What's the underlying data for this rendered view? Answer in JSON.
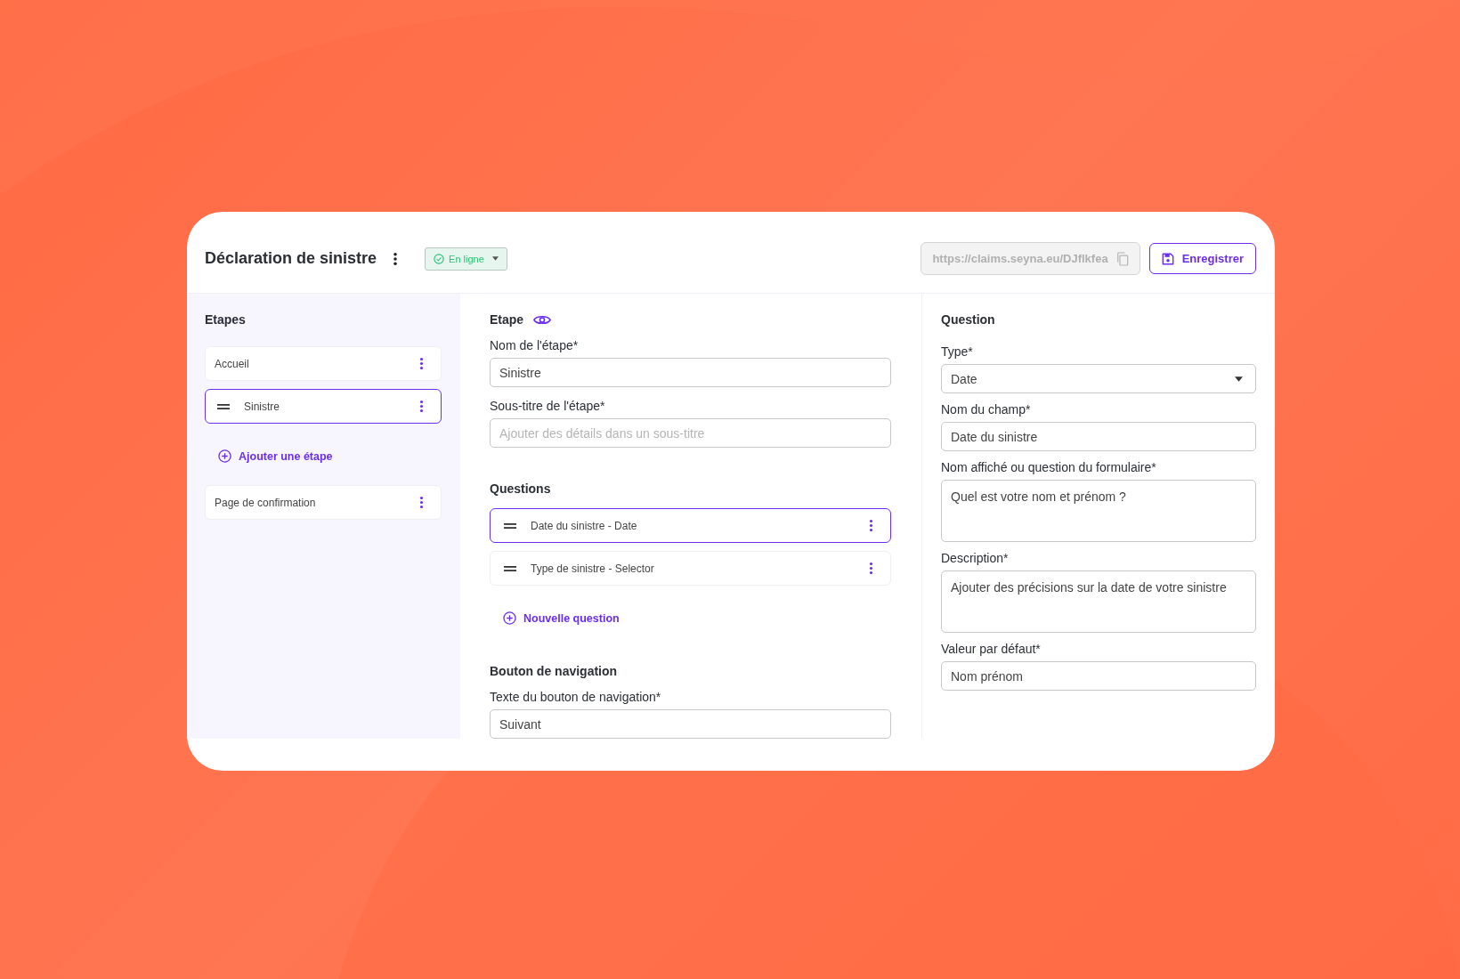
{
  "header": {
    "title": "Déclaration de sinistre",
    "status": {
      "label": "En ligne",
      "online": true
    },
    "url": "https://claims.seyna.eu/DJflkfea",
    "save_button": "Enregistrer"
  },
  "steps_panel": {
    "heading": "Etapes",
    "steps": [
      {
        "label": "Accueil",
        "selected": false,
        "handle": false
      },
      {
        "label": "Sinistre",
        "selected": true,
        "handle": true
      }
    ],
    "add_step": "Ajouter une étape",
    "final_step": {
      "label": "Page de confirmation",
      "selected": false,
      "handle": false
    }
  },
  "step_panel": {
    "heading": "Etape",
    "fields": [
      {
        "label": "Nom de l'étape*",
        "kind": "input",
        "value": "Sinistre"
      },
      {
        "label": "Sous-titre de l'étape*",
        "kind": "input",
        "placeholder": "Ajouter des détails dans un sous-titre"
      }
    ],
    "questions_heading": "Questions",
    "questions": [
      {
        "label": "Date du sinistre - Date",
        "selected": true,
        "handle": true
      },
      {
        "label": "Type de sinistre - Selector",
        "selected": false,
        "handle": true
      }
    ],
    "add_question": "Nouvelle question",
    "navigation_heading": "Bouton de navigation",
    "navigation_fields": [
      {
        "label": "Texte du bouton de navigation*",
        "kind": "input",
        "value": "Suivant"
      }
    ]
  },
  "question_panel": {
    "heading": "Question",
    "fields": [
      {
        "label": "Type*",
        "kind": "select",
        "value": "Date"
      },
      {
        "label": "Nom du champ*",
        "kind": "input",
        "value": "Date du sinistre"
      },
      {
        "label": "Nom affiché ou question du formulaire*",
        "kind": "textarea",
        "value": "Quel est votre nom et prénom ?"
      },
      {
        "label": "Description*",
        "kind": "textarea",
        "value": "Ajouter des précisions sur la date de votre sinistre"
      },
      {
        "label": "Valeur par défaut*",
        "kind": "input",
        "value": "Nom prénom"
      }
    ]
  }
}
